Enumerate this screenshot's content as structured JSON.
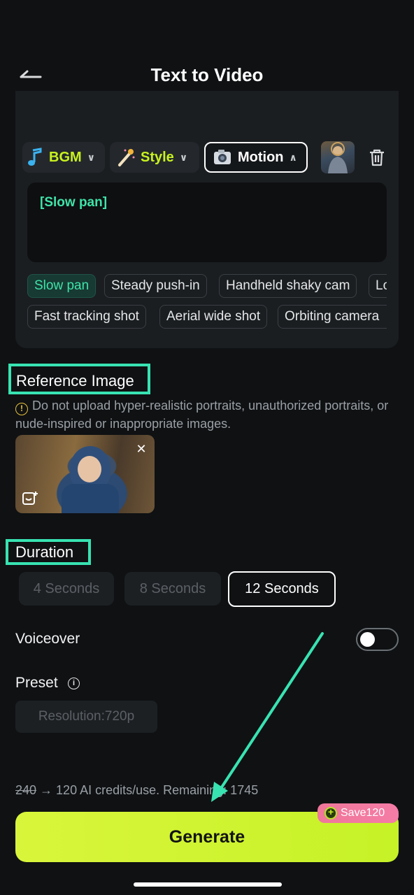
{
  "header": {
    "title": "Text to Video"
  },
  "toolbar": {
    "bgm_label": "BGM",
    "style_label": "Style",
    "motion_label": "Motion"
  },
  "prompt": {
    "text": "[Slow pan]"
  },
  "motion_tags": [
    {
      "label": "Slow pan",
      "selected": true
    },
    {
      "label": "Steady push-in"
    },
    {
      "label": "Handheld shaky cam"
    },
    {
      "label": "Lo"
    },
    {
      "label": "Fast tracking shot"
    },
    {
      "label": "Aerial wide shot"
    },
    {
      "label": "Orbiting camera"
    }
  ],
  "reference": {
    "title": "Reference Image",
    "warning": "Do not upload hyper-realistic portraits, unauthorized portraits, or nude-inspired or inappropriate images."
  },
  "duration": {
    "title": "Duration",
    "options": [
      "4 Seconds",
      "8 Seconds",
      "12 Seconds"
    ],
    "selected": "12 Seconds"
  },
  "voiceover": {
    "label": "Voiceover",
    "enabled": false
  },
  "preset": {
    "label": "Preset",
    "resolution": "Resolution:720p"
  },
  "credits": {
    "original": "240",
    "text": " → 120 AI credits/use. Remaining: 1745"
  },
  "generate": {
    "label": "Generate",
    "badge": "Save120"
  },
  "colors": {
    "accent": "#c8f21e",
    "highlight": "#38e3b2",
    "tag_selected": "#3fe3a8",
    "badge": "#f57ca6"
  }
}
